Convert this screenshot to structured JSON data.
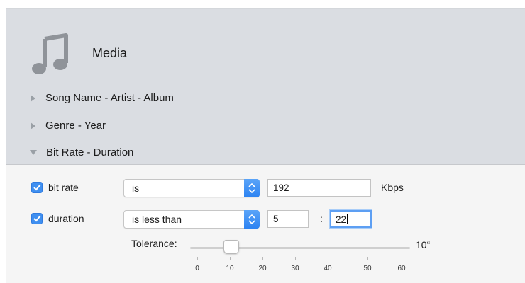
{
  "header": {
    "title": "Media",
    "icon": "music-note-icon"
  },
  "sections": [
    {
      "label": "Song Name - Artist - Album",
      "expanded": false
    },
    {
      "label": "Genre - Year",
      "expanded": false
    },
    {
      "label": "Bit Rate - Duration",
      "expanded": true
    }
  ],
  "bitrate": {
    "checked": true,
    "label": "bit rate",
    "condition": "is",
    "value": "192",
    "units": "Kbps"
  },
  "duration": {
    "checked": true,
    "label": "duration",
    "condition": "is less than",
    "minutes": "5",
    "separator": ":",
    "seconds": "22"
  },
  "tolerance": {
    "label": "Tolerance:",
    "value": 10,
    "value_text": "10“",
    "min": 0,
    "max": 60,
    "ticks": [
      "0",
      "10",
      "20",
      "30",
      "40",
      "50",
      "60"
    ]
  },
  "colors": {
    "accent": "#3f8ff0",
    "header_bg": "#dadde2",
    "body_bg": "#f5f5f5"
  }
}
